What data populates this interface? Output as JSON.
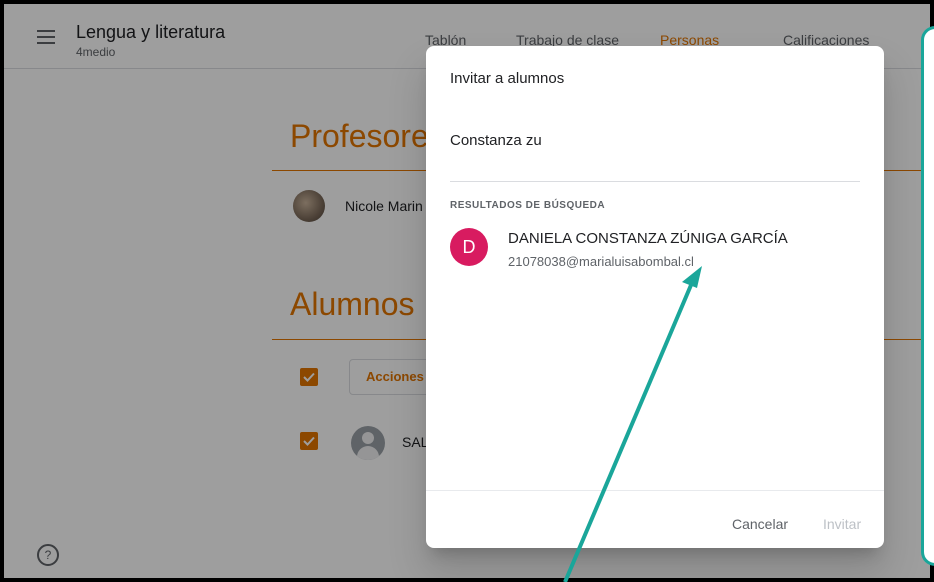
{
  "header": {
    "class_name": "Lengua y literatura",
    "class_section": "4medio",
    "tabs": [
      {
        "label": "Tablón",
        "active": false
      },
      {
        "label": "Trabajo de clase",
        "active": false
      },
      {
        "label": "Personas",
        "active": true
      },
      {
        "label": "Calificaciones",
        "active": false
      }
    ]
  },
  "people": {
    "teachers_title": "Profesores",
    "teacher_name": "Nicole Marin",
    "students_title": "Alumnos",
    "actions_label": "Acciones",
    "student_name": "SAL"
  },
  "dialog": {
    "title": "Invitar a alumnos",
    "search_value": "Constanza zu",
    "results_label": "RESULTADOS DE BÚSQUEDA",
    "result": {
      "initial": "D",
      "name": "DANIELA CONSTANZA ZÚNIGA GARCÍA",
      "email": "21078038@marialuisabombal.cl"
    },
    "cancel_label": "Cancelar",
    "invite_label": "Invitar"
  },
  "colors": {
    "accent": "#e37400",
    "result_avatar": "#d81b60",
    "annotation": "#1aa69a"
  },
  "icons": [
    "menu-icon",
    "help-icon",
    "check-icon",
    "person-icon"
  ]
}
